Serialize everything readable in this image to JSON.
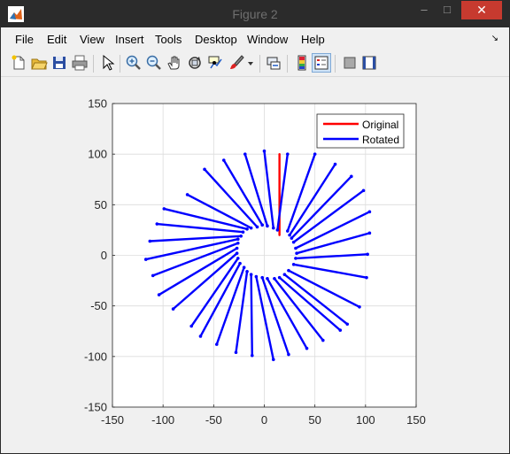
{
  "window": {
    "title": "Figure 2",
    "minimize_glyph": "–",
    "maximize_glyph": "□",
    "close_glyph": "✕"
  },
  "menu": {
    "items": [
      "File",
      "Edit",
      "View",
      "Insert",
      "Tools",
      "Desktop",
      "Window",
      "Help"
    ],
    "overflow_glyph": "↘"
  },
  "toolbar": {
    "buttons": [
      {
        "name": "new-figure-icon"
      },
      {
        "name": "open-file-icon"
      },
      {
        "name": "save-icon"
      },
      {
        "name": "print-icon"
      },
      {
        "name": "edit-plot-arrow-icon"
      },
      {
        "name": "zoom-in-icon"
      },
      {
        "name": "zoom-out-icon"
      },
      {
        "name": "pan-hand-icon"
      },
      {
        "name": "rotate-3d-icon"
      },
      {
        "name": "data-cursor-icon"
      },
      {
        "name": "brush-icon"
      },
      {
        "name": "brush-dropdown-icon"
      },
      {
        "name": "link-plot-icon"
      },
      {
        "name": "colorbar-icon"
      },
      {
        "name": "legend-icon"
      },
      {
        "name": "hide-plot-tools-icon"
      },
      {
        "name": "show-plot-tools-icon"
      }
    ]
  },
  "chart_data": {
    "type": "line",
    "title": "",
    "xlabel": "",
    "ylabel": "",
    "xlim": [
      -150,
      150
    ],
    "ylim": [
      -150,
      150
    ],
    "xticks": [
      -150,
      -100,
      -50,
      0,
      50,
      100,
      150
    ],
    "yticks": [
      150,
      100,
      50,
      0,
      -50,
      -100,
      -150
    ],
    "grid": true,
    "legend_position": "top-right",
    "colors": {
      "original": "#ff0000",
      "rotated": "#0000ff"
    },
    "series": [
      {
        "name": "Original",
        "color": "#ff0000",
        "segments": [
          [
            [
              15,
              20
            ],
            [
              15,
              100
            ]
          ]
        ]
      },
      {
        "name": "Rotated",
        "color": "#0000ff",
        "segments": [
          [
            [
              23,
              24
            ],
            [
              50,
              100
            ]
          ],
          [
            [
              25,
              20
            ],
            [
              70,
              90
            ]
          ],
          [
            [
              27,
              17
            ],
            [
              86,
              78
            ]
          ],
          [
            [
              29,
              13
            ],
            [
              98,
              64
            ]
          ],
          [
            [
              31,
              7
            ],
            [
              104,
              43
            ]
          ],
          [
            [
              32,
              2
            ],
            [
              104,
              22
            ]
          ],
          [
            [
              31,
              -3
            ],
            [
              102,
              1
            ]
          ],
          [
            [
              29,
              -9
            ],
            [
              101,
              -22
            ]
          ],
          [
            [
              24,
              -15
            ],
            [
              94,
              -51
            ]
          ],
          [
            [
              20,
              -19
            ],
            [
              82,
              -68
            ]
          ],
          [
            [
              15,
              -22
            ],
            [
              75,
              -74
            ]
          ],
          [
            [
              10,
              -23
            ],
            [
              58,
              -84
            ]
          ],
          [
            [
              3,
              -23
            ],
            [
              42,
              -92
            ]
          ],
          [
            [
              -2,
              -22
            ],
            [
              24,
              -98
            ]
          ],
          [
            [
              -8,
              -21
            ],
            [
              9,
              -103
            ]
          ],
          [
            [
              -13,
              -19
            ],
            [
              -12,
              -99
            ]
          ],
          [
            [
              -17,
              -16
            ],
            [
              -28,
              -96
            ]
          ],
          [
            [
              -20,
              -12
            ],
            [
              -47,
              -88
            ]
          ],
          [
            [
              -24,
              -8
            ],
            [
              -63,
              -80
            ]
          ],
          [
            [
              -26,
              -3
            ],
            [
              -72,
              -70
            ]
          ],
          [
            [
              -27,
              2
            ],
            [
              -90,
              -53
            ]
          ],
          [
            [
              -27,
              7
            ],
            [
              -104,
              -39
            ]
          ],
          [
            [
              -26,
              12
            ],
            [
              -110,
              -20
            ]
          ],
          [
            [
              -26,
              16
            ],
            [
              -117,
              -4
            ]
          ],
          [
            [
              -23,
              19
            ],
            [
              -113,
              14
            ]
          ],
          [
            [
              -21,
              23
            ],
            [
              -106,
              31
            ]
          ],
          [
            [
              -17,
              26
            ],
            [
              -99,
              46
            ]
          ],
          [
            [
              -13,
              27
            ],
            [
              -76,
              60
            ]
          ],
          [
            [
              -7,
              28
            ],
            [
              -59,
              85
            ]
          ],
          [
            [
              -2,
              30
            ],
            [
              -40,
              94
            ]
          ],
          [
            [
              3,
              29
            ],
            [
              -19,
              100
            ]
          ],
          [
            [
              9,
              27
            ],
            [
              0,
              103
            ]
          ],
          [
            [
              13,
              25
            ],
            [
              23,
              100
            ]
          ]
        ]
      }
    ]
  }
}
